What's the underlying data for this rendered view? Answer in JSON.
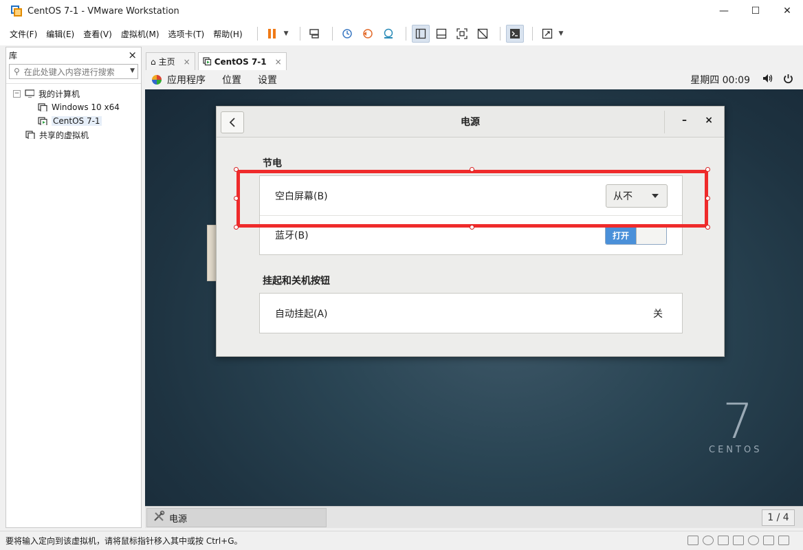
{
  "window": {
    "title": "CentOS 7-1 - VMware Workstation"
  },
  "menu": [
    "文件(F)",
    "编辑(E)",
    "查看(V)",
    "虚拟机(M)",
    "选项卡(T)",
    "帮助(H)"
  ],
  "library": {
    "title": "库",
    "close": "×",
    "search_placeholder": "在此处键入内容进行搜索",
    "tree": {
      "root": "我的计算机",
      "vm1": "Windows 10 x64",
      "vm2": "CentOS 7-1",
      "shared": "共享的虚拟机"
    }
  },
  "tabs": {
    "home": "主页",
    "vm": "CentOS 7-1",
    "close": "×"
  },
  "gnome": {
    "apps": "应用程序",
    "places": "位置",
    "settings": "设置",
    "clock": "星期四 00:09"
  },
  "dialog": {
    "back": "‹",
    "title": "电源",
    "minimize": "–",
    "close": "×",
    "section1": "节电",
    "blank_screen_label": "空白屏幕(B)",
    "blank_screen_value": "从不",
    "bluetooth_label": "蓝牙(B)",
    "bluetooth_state": "打开",
    "section2": "挂起和关机按钮",
    "auto_suspend_label": "自动挂起(A)",
    "auto_suspend_value": "关"
  },
  "desktop": {
    "brand_number": "7",
    "brand_word": "CENTOS"
  },
  "taskbar": {
    "item": "电源",
    "pager": "1 / 4"
  },
  "status": {
    "text": "要将输入定向到该虚拟机，请将鼠标指针移入其中或按 Ctrl+G。"
  },
  "colors": {
    "annotation": "#ef2b2b",
    "switch_on": "#4a90d9"
  }
}
